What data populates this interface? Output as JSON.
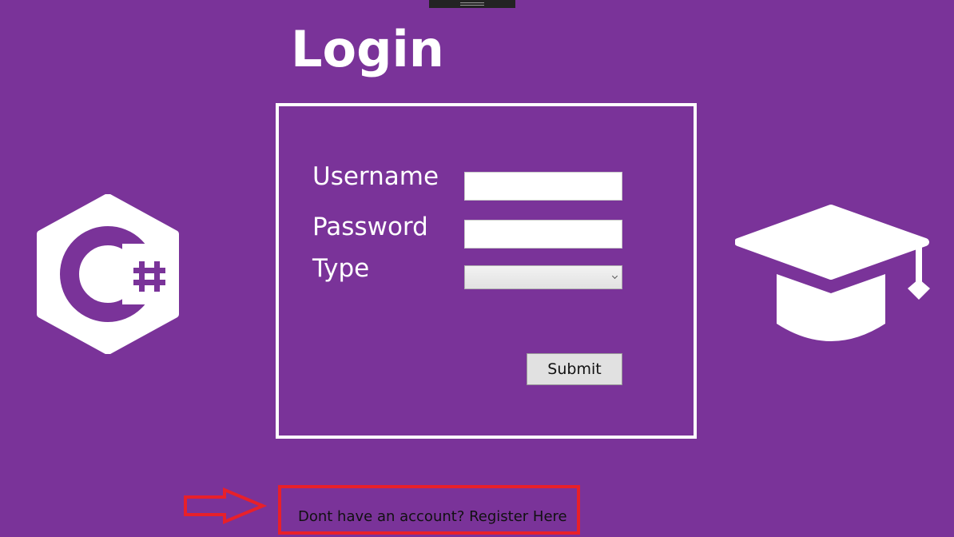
{
  "login": {
    "title": "Login",
    "username_label": "Username",
    "username_value": "",
    "password_label": "Password",
    "password_value": "",
    "type_label": "Type",
    "type_selected": "",
    "submit_label": "Submit"
  },
  "register": {
    "link_text": "Dont have an account? Register Here"
  },
  "icons": {
    "left_logo": "csharp-logo-icon",
    "right_logo": "graduation-cap-icon",
    "annotation": "arrow-right-icon"
  },
  "colors": {
    "background": "#7a3399",
    "foreground": "#ffffff",
    "annotation": "#e8202a"
  }
}
